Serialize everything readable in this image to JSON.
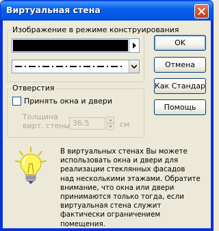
{
  "window": {
    "title": "Виртуальная стена",
    "close_glyph": "✕"
  },
  "design_group": {
    "label": "Изображение в режиме конструирования",
    "fill_combo_value": "solid-black-swatch",
    "line_combo_value": "dash-dot-line-swatch"
  },
  "buttons": {
    "ok": "OK",
    "cancel": "Отмена",
    "as_standard": "Как Стандарт",
    "help": "Помощь"
  },
  "openings_group": {
    "label": "Отверстия",
    "accept_checkbox_label": "Принять окна и двери",
    "accept_checked": false,
    "thickness_label_line1": "Толщина",
    "thickness_label_line2": "вирт. стены:",
    "thickness_value": "36.5",
    "thickness_unit": "см"
  },
  "info": {
    "icon": "lightbulb-icon",
    "text": "В виртуальных стенах Вы можете использовать окна и двери для реализации стеклянных фасадов над несколькими этажами. Обратите внимание, что окна или двери принимаются только тогда, если виртуальная стена служит фактически ограничением помещения."
  },
  "colors": {
    "titlebar": "#0a5fe6",
    "dialog_bg": "#ece9d8",
    "close_button": "#d84b22",
    "disabled_text": "#aca899"
  }
}
